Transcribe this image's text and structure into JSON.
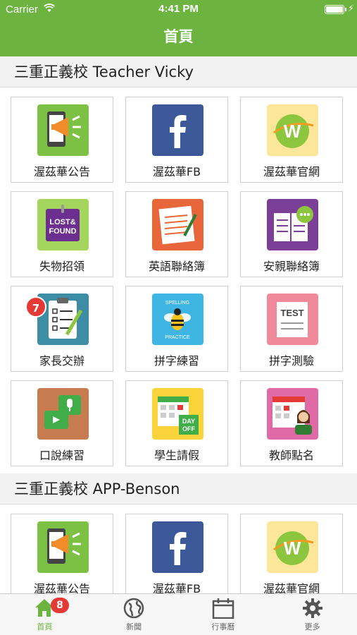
{
  "status_bar": {
    "carrier": "Carrier",
    "time": "4:41 PM"
  },
  "navbar": {
    "title": "首頁"
  },
  "sections": [
    {
      "title": "三重正義校 Teacher Vicky",
      "tiles": [
        {
          "label": "渥茲華公告",
          "icon": "announcement-icon"
        },
        {
          "label": "渥茲華FB",
          "icon": "facebook-icon"
        },
        {
          "label": "渥茲華官網",
          "icon": "website-icon"
        },
        {
          "label": "失物招領",
          "icon": "lost-found-icon",
          "icon_text": "LOST& FOUND"
        },
        {
          "label": "英語聯絡簿",
          "icon": "english-notebook-icon"
        },
        {
          "label": "安親聯絡簿",
          "icon": "afterschool-notebook-icon"
        },
        {
          "label": "家長交辦",
          "icon": "parent-tasks-icon",
          "badge": "7"
        },
        {
          "label": "拼字練習",
          "icon": "spelling-practice-icon",
          "icon_text_top": "SPELLING",
          "icon_text_bottom": "PRACTICE"
        },
        {
          "label": "拼字測驗",
          "icon": "spelling-test-icon",
          "icon_text": "TEST"
        },
        {
          "label": "口說練習",
          "icon": "speaking-practice-icon"
        },
        {
          "label": "學生請假",
          "icon": "student-leave-icon",
          "icon_text": "DAY OFF"
        },
        {
          "label": "教師點名",
          "icon": "roll-call-icon"
        }
      ]
    },
    {
      "title": "三重正義校 APP-Benson",
      "tiles": [
        {
          "label": "渥茲華公告",
          "icon": "announcement-icon"
        },
        {
          "label": "渥茲華FB",
          "icon": "facebook-icon"
        },
        {
          "label": "渥茲華官網",
          "icon": "website-icon"
        }
      ]
    }
  ],
  "tabbar": {
    "items": [
      {
        "label": "首頁",
        "icon": "home-icon",
        "badge": "8",
        "active": true
      },
      {
        "label": "新聞",
        "icon": "globe-icon"
      },
      {
        "label": "行事曆",
        "icon": "calendar-icon"
      },
      {
        "label": "更多",
        "icon": "gear-icon"
      }
    ]
  },
  "colors": {
    "brand_green": "#6cb33f",
    "badge_red": "#e53935"
  }
}
